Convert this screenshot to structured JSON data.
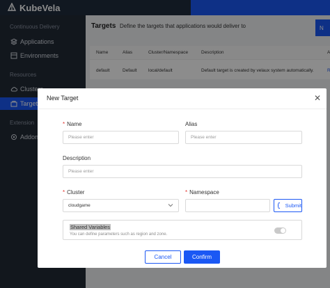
{
  "app": {
    "name": "KubeVela"
  },
  "sidebar": {
    "groups": [
      {
        "label": "Continuous Delivery"
      },
      {
        "label": "Resources"
      },
      {
        "label": "Extension"
      }
    ],
    "items": [
      {
        "label": "Applications",
        "icon": "app-icon"
      },
      {
        "label": "Environments",
        "icon": "environment-icon"
      },
      {
        "label": "Clusters",
        "icon": "cloud-icon"
      },
      {
        "label": "Targets",
        "icon": "target-icon",
        "active": true
      },
      {
        "label": "Addons",
        "icon": "addon-icon"
      }
    ]
  },
  "page": {
    "title": "Targets",
    "subtitle": "Define the targets that applications would deliver to",
    "new_button": "N"
  },
  "table": {
    "columns": [
      "Name",
      "Alias",
      "Cluster/Namespace",
      "Description",
      "A"
    ],
    "rows": [
      {
        "name": "default",
        "alias": "Default",
        "cluster_ns": "local/default",
        "description": "Default target is created by velaux system automatically.",
        "action": "R"
      }
    ]
  },
  "modal": {
    "title": "New Target",
    "fields": {
      "name": {
        "label": "Name",
        "required": true,
        "placeholder": "Please enter",
        "value": ""
      },
      "alias": {
        "label": "Alias",
        "required": false,
        "placeholder": "Please enter",
        "value": ""
      },
      "description": {
        "label": "Description",
        "required": false,
        "placeholder": "Please enter",
        "value": ""
      },
      "cluster": {
        "label": "Cluster",
        "required": true,
        "value": "cloudgame"
      },
      "namespace": {
        "label": "Namespace",
        "required": true,
        "placeholder": "",
        "value": ""
      }
    },
    "submit_label": "Submit",
    "shared_variables": {
      "title": "Shared Variables",
      "description": "You can define parameters such as region and zone.",
      "enabled": false
    },
    "cancel_label": "Cancel",
    "confirm_label": "Confirm"
  },
  "colors": {
    "primary": "#1b58f4",
    "sidebar_bg": "#222a36",
    "topbar_bg": "#1f2d3d",
    "required": "#e3342f"
  }
}
